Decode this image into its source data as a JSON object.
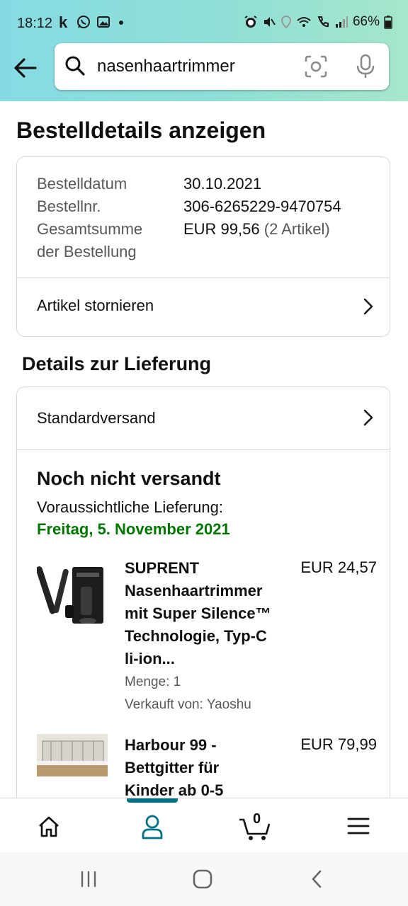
{
  "status_bar": {
    "time": "18:12",
    "battery": "66%",
    "left_icons": [
      "k-app-icon",
      "whatsapp-icon",
      "gallery-icon",
      "dot-icon"
    ],
    "right_icons": [
      "alarm-icon",
      "mute-icon",
      "location-icon",
      "wifi-icon",
      "call-icon",
      "signal-icon",
      "battery-icon"
    ]
  },
  "search": {
    "query": "nasenhaartrimmer"
  },
  "page": {
    "title": "Bestelldetails anzeigen"
  },
  "order_info": {
    "date_label": "Bestelldatum",
    "number_label": "Bestellnr.",
    "total_label_line1": "Gesamtsumme",
    "total_label_line2": "der Bestellung",
    "date_value": "30.10.2021",
    "number_value": "306-6265229-9470754",
    "total_value": "EUR 99,56",
    "total_items": "(2 Artikel)",
    "cancel_link": "Artikel stornieren"
  },
  "delivery": {
    "section_title": "Details zur Lieferung",
    "shipping_method": "Standardversand",
    "status": "Noch nicht versandt",
    "eta_label": "Voraussichtliche Lieferung:",
    "eta_date": "Freitag, 5. November 2021"
  },
  "items": [
    {
      "title_lines": [
        "SUPRENT",
        "Nasenhaartrimmer",
        "mit Super Silence™",
        "Technologie, Typ-C",
        "li-ion..."
      ],
      "price": "EUR 24,57",
      "quantity": "Menge: 1",
      "seller": "Verkauft von: Yaoshu"
    },
    {
      "title_lines": [
        "Harbour 99 -",
        "Bettgitter für",
        "Kinder ab 0-5"
      ],
      "price": "EUR 79,99"
    }
  ],
  "bottom_nav": {
    "cart_count": "0",
    "active_tab": "account",
    "accent": "#007185"
  },
  "colors": {
    "delivery_green": "#007600",
    "header_gradient_start": "#86dbe3",
    "header_gradient_end": "#a6e6cb"
  }
}
